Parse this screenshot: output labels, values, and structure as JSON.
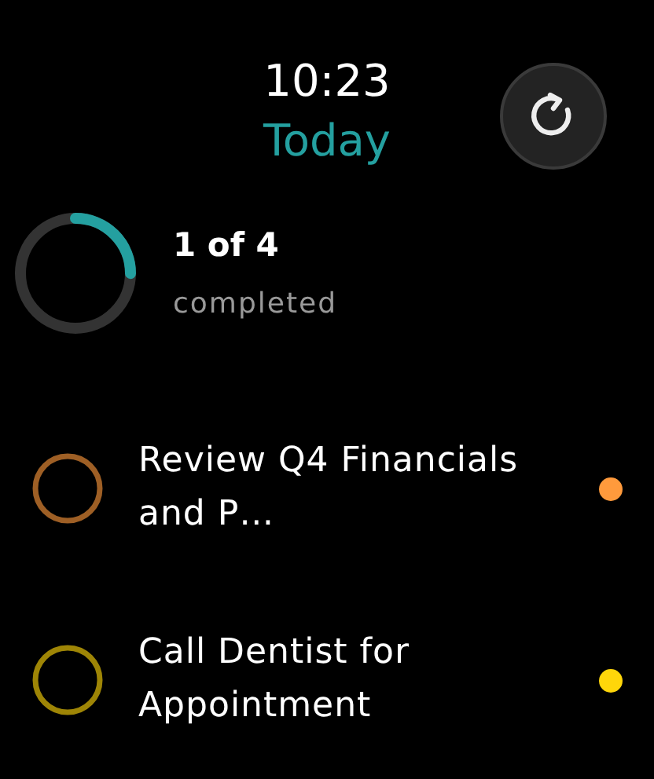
{
  "header": {
    "time": "10:23",
    "title": "Today"
  },
  "progress": {
    "level": 0.25,
    "count": "1 of 4",
    "label": "completed"
  },
  "tasks": [
    {
      "title": "Review Q4 Financials and P…",
      "completed": false,
      "color": "#ff9a3c"
    },
    {
      "title": "Call Dentist for Appointment",
      "completed": false,
      "color": "#ffd60a"
    }
  ]
}
